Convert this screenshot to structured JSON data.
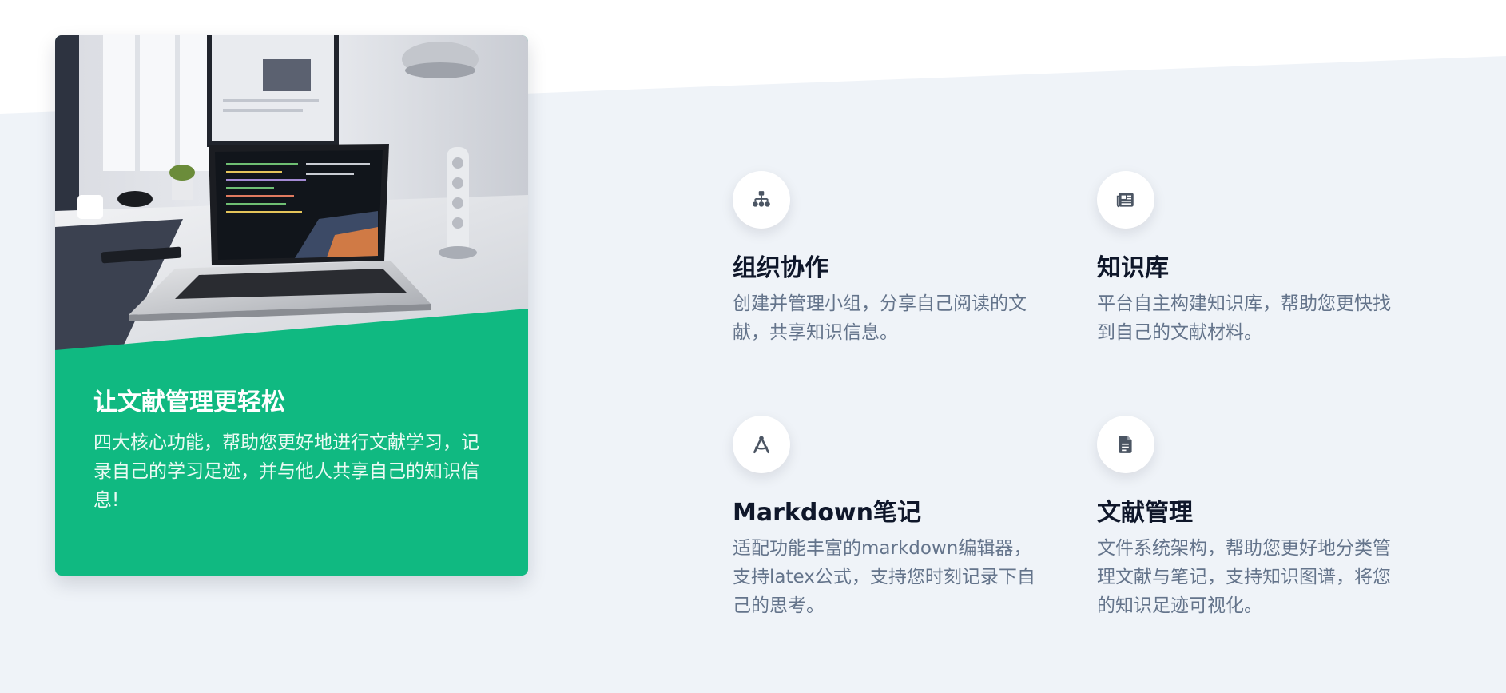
{
  "colors": {
    "page_background_top": "#ffffff",
    "page_background_lower": "#eff3f8",
    "accent_green": "#10b981",
    "icon_color": "#4b5563",
    "title_color": "#0f172a",
    "text_muted": "#64748b"
  },
  "hero_card": {
    "image_alt": "laptop on desk with code editor",
    "title": "让文献管理更轻松",
    "description": "四大核心功能，帮助您更好地进行文献学习，记录自己的学习足迹，并与他人共享自己的知识信息!"
  },
  "features": [
    {
      "icon": "sitemap-icon",
      "title": "组织协作",
      "description": "创建并管理小组，分享自己阅读的文献，共享知识信息。"
    },
    {
      "icon": "newspaper-icon",
      "title": "知识库",
      "description": "平台自主构建知识库，帮助您更快找到自己的文献材料。"
    },
    {
      "icon": "compass-drafting-icon",
      "title": "Markdown笔记",
      "description": "适配功能丰富的markdown编辑器，支持latex公式，支持您时刻记录下自己的思考。"
    },
    {
      "icon": "file-icon",
      "title": "文献管理",
      "description": "文件系统架构，帮助您更好地分类管理文献与笔记，支持知识图谱，将您的知识足迹可视化。"
    }
  ]
}
